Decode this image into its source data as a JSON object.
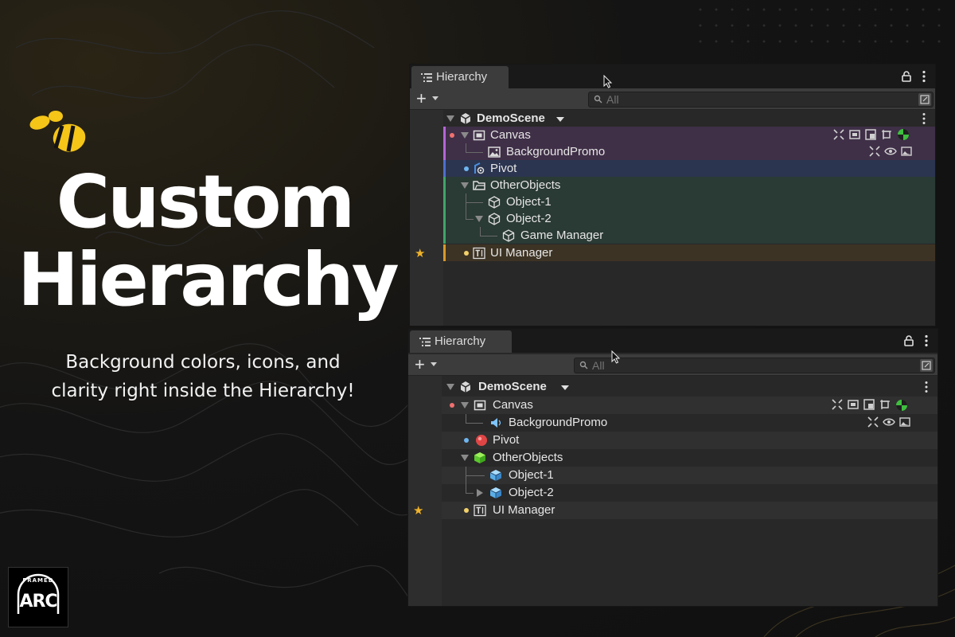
{
  "headline": {
    "line1": "Custom",
    "line2": "Hierarchy"
  },
  "subtitle": {
    "line1": "Background colors, icons, and",
    "line2": "clarity right inside the Hierarchy!"
  },
  "brand": {
    "small": "FRAMED",
    "name": "ARC"
  },
  "colors": {
    "accent_gold": "#f5c518",
    "canvas_bg": "#3f2f47",
    "pivot_bg": "#2b3550",
    "objects_bg": "#2a3a35",
    "ui_bg": "#3d3324",
    "star": "#f0b32a"
  },
  "panel_top": {
    "tab": "Hierarchy",
    "search_placeholder": "All",
    "scene": "DemoScene",
    "rows": [
      "Canvas",
      "BackgroundPromo",
      "Pivot",
      "OtherObjects",
      "Object-1",
      "Object-2",
      "Game Manager",
      "UI Manager"
    ],
    "star": "★"
  },
  "panel_bottom": {
    "tab": "Hierarchy",
    "search_placeholder": "All",
    "scene": "DemoScene",
    "rows": [
      "Canvas",
      "BackgroundPromo",
      "Pivot",
      "OtherObjects",
      "Object-1",
      "Object-2",
      "UI Manager"
    ],
    "star": "★"
  }
}
